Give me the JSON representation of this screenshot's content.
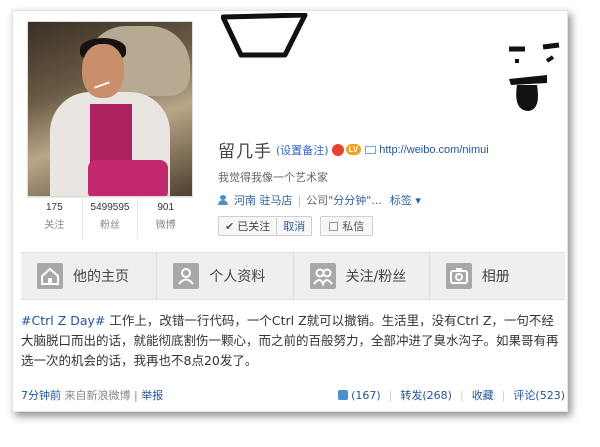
{
  "profile": {
    "name": "留几手",
    "remark_link": "(设置备注)",
    "vip_badge": "LV",
    "url": "http://weibo.com/nimui",
    "bio": "我觉得我像一个艺术家",
    "location": "河南 驻马店",
    "company_prefix": "公司",
    "company_name": "\"分分钟\"...",
    "tags_label": "标签 ▾"
  },
  "stats": [
    {
      "num": "175",
      "label": "关注"
    },
    {
      "num": "5499595",
      "label": "粉丝"
    },
    {
      "num": "901",
      "label": "微博"
    }
  ],
  "actions": {
    "followed_label": "已关注",
    "cancel_label": "取消",
    "message_label": "私信"
  },
  "nav": {
    "items": [
      {
        "label": "他的主页",
        "icon": "home-icon"
      },
      {
        "label": "个人资料",
        "icon": "profile-icon"
      },
      {
        "label": "关注/粉丝",
        "icon": "followers-icon"
      },
      {
        "label": "相册",
        "icon": "camera-icon"
      }
    ]
  },
  "post": {
    "hashtag": "#Ctrl Z Day#",
    "text": " 工作上，改错一行代码，一个Ctrl Z就可以撤销。生活里，没有Ctrl Z，一句不经大脑脱口而出的话，就能彻底割伤一颗心，而之前的百般努力，全部冲进了臭水沟子。如果哥有再选一次的机会的话，我再也不8点20发了。",
    "time": "7分钟前",
    "source": "来自新浪微博",
    "report": "举报",
    "like": "(167)",
    "repost": "转发(268)",
    "favorite": "收藏",
    "comment": "评论(523)",
    "separator": "|"
  },
  "colors": {
    "link": "#225599",
    "nav_bg": "#efefef",
    "icon_gray": "#a8a8a8"
  }
}
